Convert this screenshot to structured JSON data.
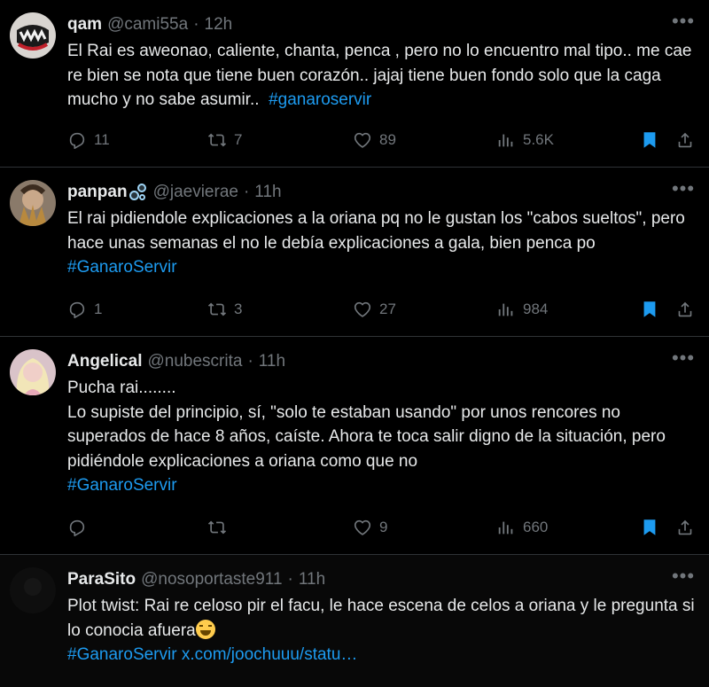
{
  "colors": {
    "background": "#000000",
    "text": "#e7e9ea",
    "muted": "#71767b",
    "accent": "#1d9bf0",
    "divider": "#2f3336"
  },
  "tweets": [
    {
      "name": "qam",
      "handle": "@cami55a",
      "time": "12h",
      "more": "•••",
      "text_main": "El Rai es aweonao, caliente, chanta, penca , pero no lo encuentro mal tipo.. me cae re bien se nota que tiene buen corazón.. jajaj tiene buen fondo solo que la caga mucho y no sabe asumir..  ",
      "hashtag": "#ganaroservir",
      "replies": "11",
      "retweets": "7",
      "likes": "89",
      "views": "5.6K",
      "bookmarked": true
    },
    {
      "name": "panpan",
      "handle": "@jaevierae",
      "time": "11h",
      "more": "•••",
      "text_main": "El rai pidiendole explicaciones a la oriana pq no le gustan los \"cabos sueltos\", pero hace unas semanas el no le debía explicaciones a gala, bien penca po ",
      "hashtag": "#GanaroServir",
      "replies": "1",
      "retweets": "3",
      "likes": "27",
      "views": "984",
      "bookmarked": true
    },
    {
      "name": "Angelical",
      "handle": "@nubescrita",
      "time": "11h",
      "more": "•••",
      "text_main": "Pucha rai........\nLo supiste del principio, sí, \"solo te estaban usando\" por unos rencores no superados de hace 8 años, caíste. Ahora te toca salir digno de la situación, pero pidiéndole explicaciones a oriana como que no\n",
      "hashtag": "#GanaroServir",
      "replies": "",
      "retweets": "",
      "likes": "9",
      "views": "660",
      "bookmarked": true
    },
    {
      "name": "ParaSito",
      "handle": "@nosoportaste911",
      "time": "11h",
      "more": "•••",
      "text_main": "Plot twist: Rai re celoso pir el facu, le hace escena de celos a oriana y le pregunta si lo conocia afuera",
      "hashtag": "#GanaroServir",
      "link": "x.com/joochuuu/statu…",
      "emoji": "face-with-tears-of-joy"
    }
  ]
}
